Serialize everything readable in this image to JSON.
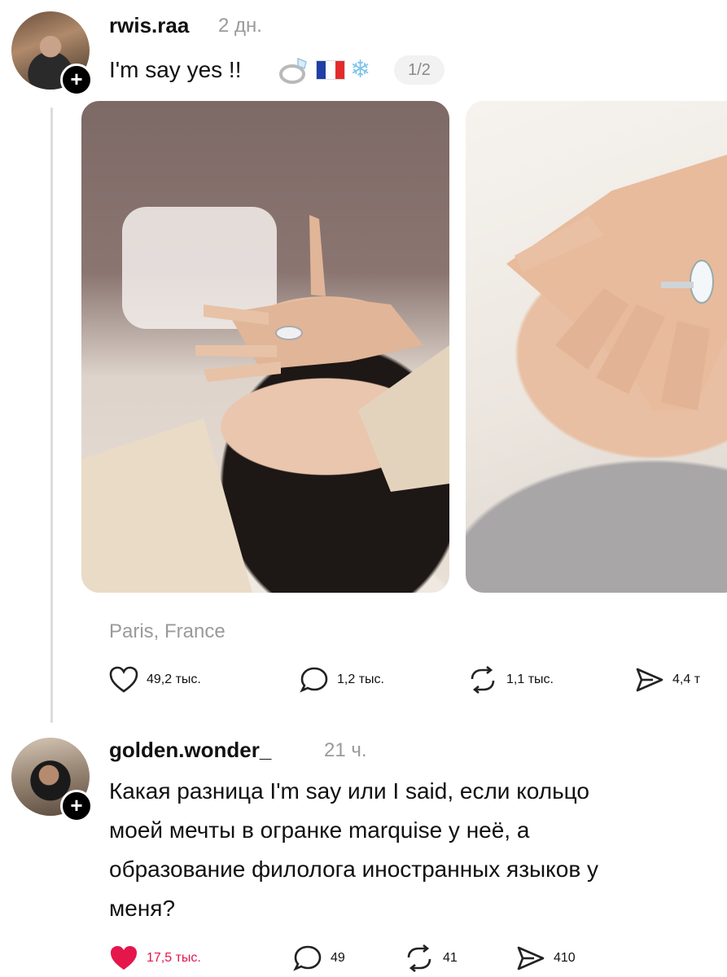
{
  "post": {
    "username": "rwis.raa",
    "time": "2 дн.",
    "text": "I'm say yes !!",
    "emoji": {
      "ring": "ring-icon",
      "flag": "france-flag-icon",
      "snow": "snowflake-icon"
    },
    "media_counter": "1/2",
    "location": "Paris, France",
    "actions": {
      "likes": "49,2 тыс.",
      "comments": "1,2 тыс.",
      "reposts": "1,1 тыс.",
      "shares": "4,4 т"
    }
  },
  "reply": {
    "username": "golden.wonder_",
    "time": "21 ч.",
    "text_lines": [
      "Какая разница I'm say или I said, если кольцо",
      "моей мечты в огранке marquise у неё, а",
      "образование филолога иностранных языков у",
      "меня?"
    ],
    "actions": {
      "likes": "17,5 тыс.",
      "comments": "49",
      "reposts": "41",
      "shares": "410"
    }
  },
  "colors": {
    "like_active": "#e5164b",
    "muted_text": "#9a9a9a"
  }
}
